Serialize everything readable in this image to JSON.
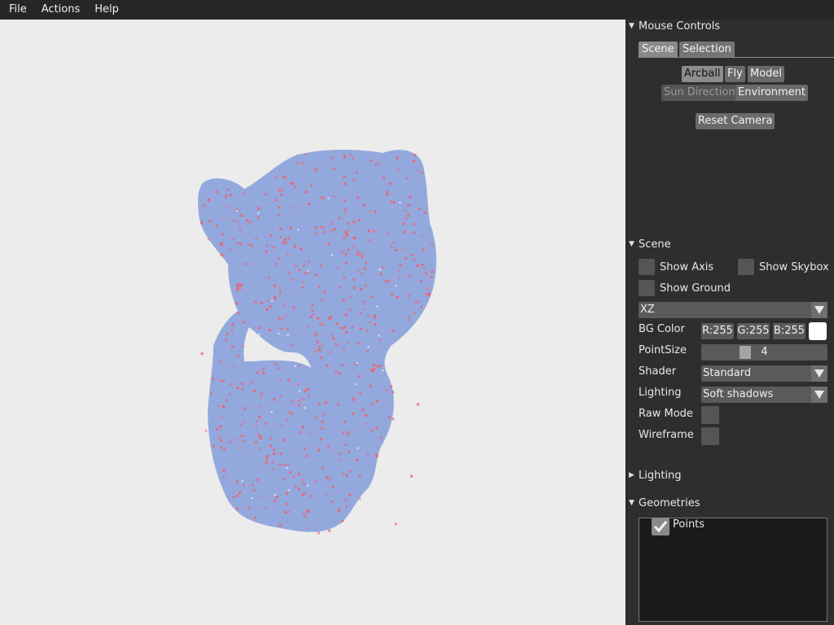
{
  "menu": [
    "File",
    "Actions",
    "Help"
  ],
  "mouse_controls": {
    "header": "Mouse Controls",
    "tabs": [
      "Scene",
      "Selection"
    ],
    "modes": [
      "Arcball",
      "Fly",
      "Model"
    ],
    "modes2": [
      "Sun Direction",
      "Environment"
    ],
    "reset": "Reset Camera"
  },
  "scene": {
    "header": "Scene",
    "show_axis": "Show Axis",
    "show_skybox": "Show Skybox",
    "show_ground": "Show Ground",
    "ground_plane": "XZ",
    "bg_color_label": "BG Color",
    "bg_r": "R:255",
    "bg_g": "G:255",
    "bg_b": "B:255",
    "bg_color": "#ffffff",
    "point_size_label": "PointSize",
    "point_size": "4",
    "shader_label": "Shader",
    "shader": "Standard",
    "lighting_label": "Lighting",
    "lighting": "Soft shadows",
    "raw_mode": "Raw Mode",
    "wireframe": "Wireframe"
  },
  "lighting_section": {
    "header": "Lighting"
  },
  "geometries": {
    "header": "Geometries",
    "items": [
      {
        "label": "Points",
        "checked": true
      }
    ]
  },
  "colors": {
    "point_cloud": "#93a9de",
    "outliers": "#f0606a",
    "viewport_bg": "#ececec"
  }
}
